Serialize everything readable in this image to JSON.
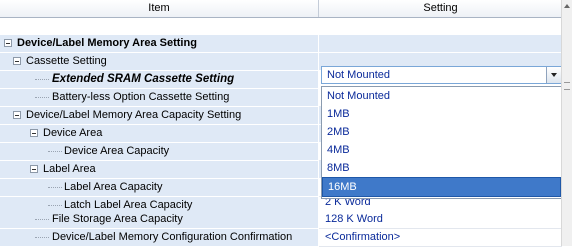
{
  "header": {
    "item": "Item",
    "setting": "Setting"
  },
  "rows": [
    {
      "label": "Device/Label Memory Area Setting",
      "value": ""
    },
    {
      "label": "Cassette Setting",
      "value": ""
    },
    {
      "label": "Extended SRAM Cassette Setting",
      "value": "Not Mounted"
    },
    {
      "label": "Battery-less Option Cassette Setting",
      "value": ""
    },
    {
      "label": "Device/Label Memory Area Capacity Setting",
      "value": ""
    },
    {
      "label": "Device Area",
      "value": ""
    },
    {
      "label": "Device Area Capacity",
      "value": ""
    },
    {
      "label": "Label Area",
      "value": ""
    },
    {
      "label": "Label Area Capacity",
      "value": ""
    },
    {
      "label": "Latch Label Area Capacity",
      "value": "2 K Word"
    },
    {
      "label": "File Storage Area Capacity",
      "value": "128 K Word"
    },
    {
      "label": "Device/Label Memory Configuration Confirmation",
      "value": "<Confirmation>"
    }
  ],
  "dropdown": {
    "selected": "Not Mounted",
    "options": [
      "Not Mounted",
      "1MB",
      "2MB",
      "4MB",
      "8MB",
      "16MB"
    ],
    "highlighted": "16MB"
  },
  "icons": {
    "expander": "minus-box-icon",
    "dropdown_arrow": "chevron-down-icon",
    "scroll_up": "arrow-up-icon"
  },
  "colors": {
    "row_bg": "#dfe9f6",
    "value_text": "#0a2a9a",
    "highlight": "#3f79c9"
  }
}
